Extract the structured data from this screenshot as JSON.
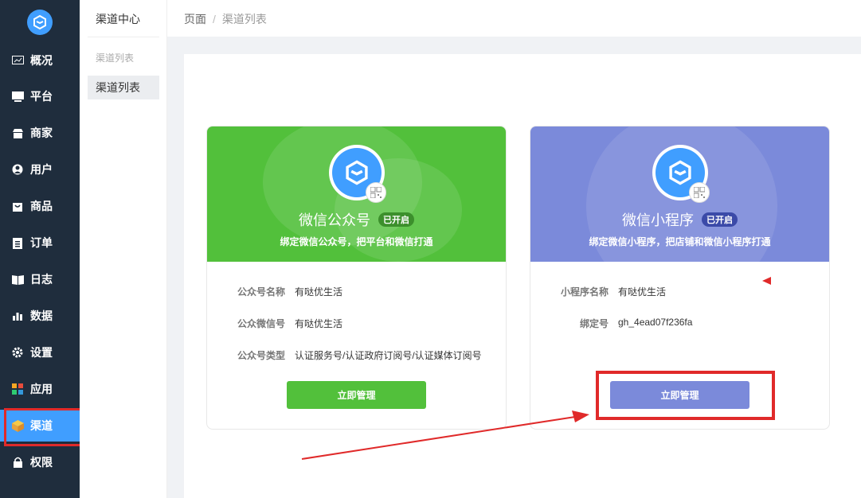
{
  "sidebar": {
    "items": [
      {
        "label": "概况",
        "icon": "monitor-chart-icon"
      },
      {
        "label": "平台",
        "icon": "desktop-icon"
      },
      {
        "label": "商家",
        "icon": "store-icon"
      },
      {
        "label": "用户",
        "icon": "user-icon"
      },
      {
        "label": "商品",
        "icon": "bag-icon"
      },
      {
        "label": "订单",
        "icon": "order-icon"
      },
      {
        "label": "日志",
        "icon": "book-icon"
      },
      {
        "label": "数据",
        "icon": "bar-chart-icon"
      },
      {
        "label": "设置",
        "icon": "gear-icon"
      },
      {
        "label": "应用",
        "icon": "apps-grid-icon"
      },
      {
        "label": "渠道",
        "icon": "cube-icon",
        "active": true
      },
      {
        "label": "权限",
        "icon": "lock-icon"
      }
    ]
  },
  "subsidebar": {
    "title": "渠道中心",
    "group": "渠道列表",
    "item": "渠道列表"
  },
  "breadcrumb": {
    "root": "页面",
    "separator": "/",
    "current": "渠道列表"
  },
  "cards": [
    {
      "title": "微信公众号",
      "badge": "已开启",
      "subtitle": "绑定微信公众号，把平台和微信打通",
      "color": "#52c03b",
      "fields": [
        {
          "key": "公众号名称",
          "value": "有哒优生活"
        },
        {
          "key": "公众微信号",
          "value": "有哒优生活"
        },
        {
          "key": "公众号类型",
          "value": "认证服务号/认证政府订阅号/认证媒体订阅号"
        }
      ],
      "button": "立即管理"
    },
    {
      "title": "微信小程序",
      "badge": "已开启",
      "subtitle": "绑定微信小程序，把店铺和微信小程序打通",
      "color": "#7b8ada",
      "fields": [
        {
          "key": "小程序名称",
          "value": "有哒优生活"
        },
        {
          "key": "绑定号",
          "value": "gh_4ead07f236fa"
        }
      ],
      "button": "立即管理"
    }
  ],
  "colors": {
    "sidebar_bg": "#1f2d3d",
    "active": "#409eff",
    "annotation": "#e02a2a"
  }
}
